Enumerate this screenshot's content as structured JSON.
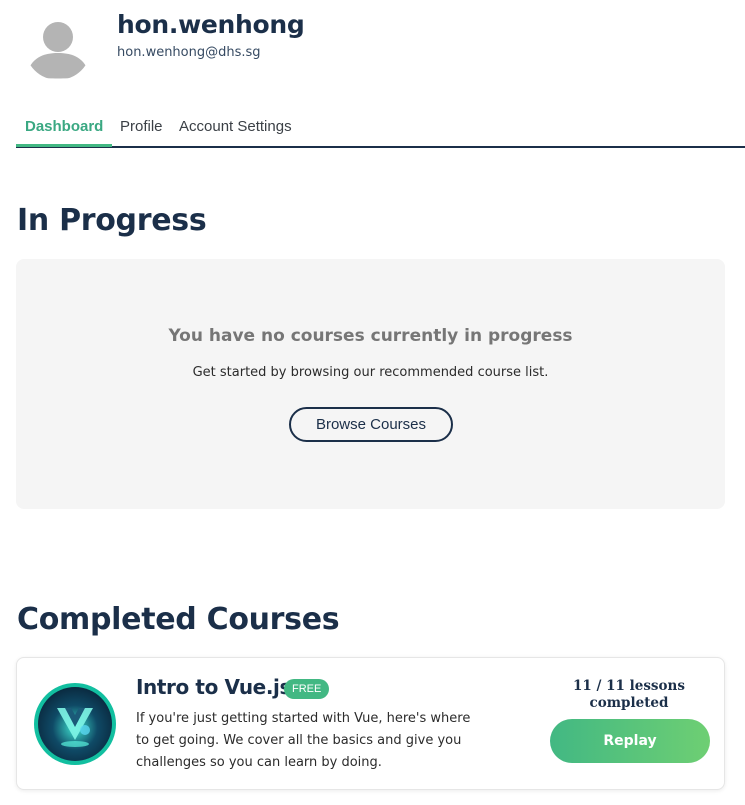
{
  "user": {
    "username": "hon.wenhong",
    "email": "hon.wenhong@dhs.sg",
    "avatar_icon": "user-silhouette-icon"
  },
  "tabs": [
    {
      "label": "Dashboard",
      "active": true
    },
    {
      "label": "Profile",
      "active": false
    },
    {
      "label": "Account Settings",
      "active": false
    }
  ],
  "in_progress": {
    "title": "In Progress",
    "empty_title": "You have no courses currently in progress",
    "empty_subtitle": "Get started by browsing our recommended course list.",
    "browse_label": "Browse Courses"
  },
  "completed": {
    "title": "Completed Courses",
    "courses": [
      {
        "title": "Intro to Vue.js",
        "badge": "FREE",
        "description": "If you're just getting started with Vue, here's where to get going. We cover all the basics and give you challenges so you can learn by doing.",
        "progress": "11 / 11 lessons completed",
        "action_label": "Replay",
        "icon": "vue-logo-icon"
      }
    ]
  },
  "colors": {
    "brand_navy": "#1b2f49",
    "accent_green": "#42b883",
    "panel_bg": "#f5f5f5"
  }
}
